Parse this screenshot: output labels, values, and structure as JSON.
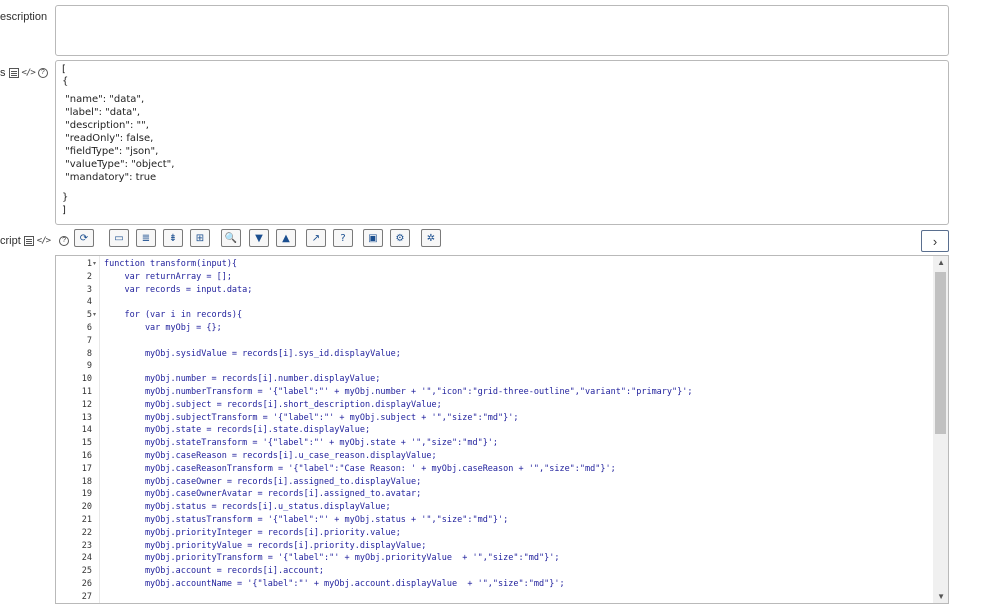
{
  "labels": {
    "description": "escription",
    "fields": "s",
    "script": "cript"
  },
  "json_lines": [
    "[",
    "{",
    " \"name\": \"data\",",
    " \"label\": \"data\",",
    " \"description\": \"\",",
    " \"readOnly\": false,",
    " \"fieldType\": \"json\",",
    " \"valueType\": \"object\",",
    " \"mandatory\": true",
    "}",
    "]"
  ],
  "toolbar": {
    "buttons": [
      {
        "name": "format-code-icon",
        "glyph": "⟳"
      },
      {
        "name": "comment-icon",
        "glyph": "▭"
      },
      {
        "name": "uncomment-icon",
        "glyph": "≣"
      },
      {
        "name": "insert-line-icon",
        "glyph": "⇟"
      },
      {
        "name": "script-include-icon",
        "glyph": "⊞"
      },
      {
        "name": "search-icon",
        "glyph": "🔍"
      },
      {
        "name": "find-next-icon",
        "glyph": "▼"
      },
      {
        "name": "find-previous-icon",
        "glyph": "▲"
      },
      {
        "name": "open-icon",
        "glyph": "↗"
      },
      {
        "name": "help-icon",
        "glyph": "?"
      },
      {
        "name": "save-icon",
        "glyph": "▣"
      },
      {
        "name": "debug-icon",
        "glyph": "⚙"
      },
      {
        "name": "settings-icon",
        "glyph": "✲"
      }
    ],
    "expand_glyph": "›"
  },
  "code": {
    "lines": [
      {
        "n": "1",
        "fold": true,
        "text": "function transform(input){"
      },
      {
        "n": "2",
        "text": "    var returnArray = [];"
      },
      {
        "n": "3",
        "text": "    var records = input.data;"
      },
      {
        "n": "4",
        "text": ""
      },
      {
        "n": "5",
        "fold": true,
        "text": "    for (var i in records){"
      },
      {
        "n": "6",
        "text": "        var myObj = {};"
      },
      {
        "n": "7",
        "text": ""
      },
      {
        "n": "8",
        "text": "        myObj.sysidValue = records[i].sys_id.displayValue;"
      },
      {
        "n": "9",
        "text": ""
      },
      {
        "n": "10",
        "text": "        myObj.number = records[i].number.displayValue;"
      },
      {
        "n": "11",
        "text": "        myObj.numberTransform = '{\"label\":\"' + myObj.number + '\",\"icon\":\"grid-three-outline\",\"variant\":\"primary\"}';"
      },
      {
        "n": "12",
        "text": "        myObj.subject = records[i].short_description.displayValue;"
      },
      {
        "n": "13",
        "text": "        myObj.subjectTransform = '{\"label\":\"' + myObj.subject + '\",\"size\":\"md\"}';"
      },
      {
        "n": "14",
        "text": "        myObj.state = records[i].state.displayValue;"
      },
      {
        "n": "15",
        "text": "        myObj.stateTransform = '{\"label\":\"' + myObj.state + '\",\"size\":\"md\"}';"
      },
      {
        "n": "16",
        "text": "        myObj.caseReason = records[i].u_case_reason.displayValue;"
      },
      {
        "n": "17",
        "text": "        myObj.caseReasonTransform = '{\"label\":\"Case Reason: ' + myObj.caseReason + '\",\"size\":\"md\"}';"
      },
      {
        "n": "18",
        "text": "        myObj.caseOwner = records[i].assigned_to.displayValue;"
      },
      {
        "n": "19",
        "text": "        myObj.caseOwnerAvatar = records[i].assigned_to.avatar;"
      },
      {
        "n": "20",
        "text": "        myObj.status = records[i].u_status.displayValue;"
      },
      {
        "n": "21",
        "text": "        myObj.statusTransform = '{\"label\":\"' + myObj.status + '\",\"size\":\"md\"}';"
      },
      {
        "n": "22",
        "text": "        myObj.priorityInteger = records[i].priority.value;"
      },
      {
        "n": "23",
        "text": "        myObj.priorityValue = records[i].priority.displayValue;"
      },
      {
        "n": "24",
        "text": "        myObj.priorityTransform = '{\"label\":\"' + myObj.priorityValue  + '\",\"size\":\"md\"}';"
      },
      {
        "n": "25",
        "text": "        myObj.account = records[i].account;"
      },
      {
        "n": "26",
        "text": "        myObj.accountName = '{\"label\":\"' + myObj.account.displayValue  + '\",\"size\":\"md\"}';"
      },
      {
        "n": "27",
        "text": ""
      }
    ]
  }
}
